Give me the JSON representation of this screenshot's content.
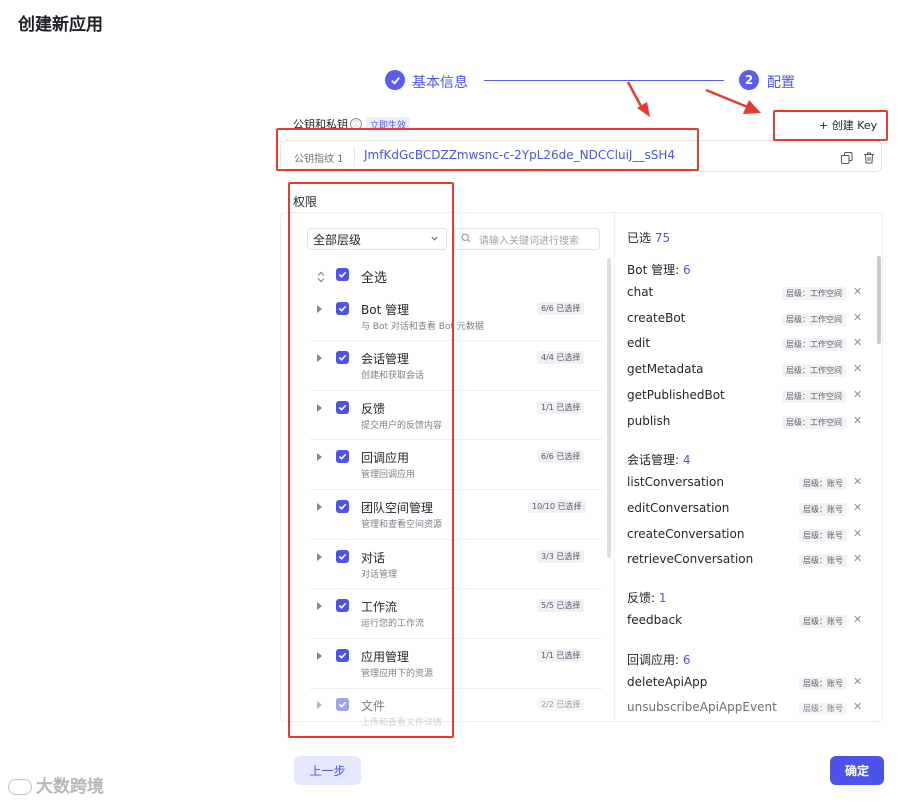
{
  "page": {
    "title": "创建新应用"
  },
  "stepper": {
    "step1": {
      "label": "基本信息"
    },
    "step2": {
      "number": "2",
      "label": "配置"
    }
  },
  "keys": {
    "section_label": "公钥和私钥",
    "info_icon": "ⓘ",
    "tag": "立即生效",
    "create_button": "+ 创建 Key",
    "fingerprint_label": "公钥指纹 1",
    "fingerprint_value": "JmfKdGcBCDZZmwsnc-c-2YpL26de_NDCCluiJ__sSH4"
  },
  "permissions": {
    "title": "权限",
    "filter_value": "全部层级",
    "search_placeholder": "请输入关键词进行搜索",
    "select_all": "全选",
    "groups": [
      {
        "name": "Bot 管理",
        "desc": "与 Bot 对话和查看 Bot 元数据",
        "badge": "6/6 已选择"
      },
      {
        "name": "会话管理",
        "desc": "创建和获取会话",
        "badge": "4/4 已选择"
      },
      {
        "name": "反馈",
        "desc": "提交用户的反馈内容",
        "badge": "1/1 已选择"
      },
      {
        "name": "回调应用",
        "desc": "管理回调应用",
        "badge": "6/6 已选择"
      },
      {
        "name": "团队空间管理",
        "desc": "管理和查看空间资源",
        "badge": "10/10 已选择"
      },
      {
        "name": "对话",
        "desc": "对话管理",
        "badge": "3/3 已选择"
      },
      {
        "name": "工作流",
        "desc": "运行您的工作流",
        "badge": "5/5 已选择"
      },
      {
        "name": "应用管理",
        "desc": "管理应用下的资源",
        "badge": "1/1 已选择"
      },
      {
        "name": "文件",
        "desc": "上传和查看文件详情",
        "badge": "2/2 已选择"
      }
    ]
  },
  "selected": {
    "label": "已选",
    "total": "75",
    "groups": [
      {
        "name": "Bot 管理:",
        "count": "6",
        "items": [
          {
            "api": "chat",
            "scope": "层级：工作空间"
          },
          {
            "api": "createBot",
            "scope": "层级：工作空间"
          },
          {
            "api": "edit",
            "scope": "层级：工作空间"
          },
          {
            "api": "getMetadata",
            "scope": "层级：工作空间"
          },
          {
            "api": "getPublishedBot",
            "scope": "层级：工作空间"
          },
          {
            "api": "publish",
            "scope": "层级：工作空间"
          }
        ]
      },
      {
        "name": "会话管理:",
        "count": "4",
        "items": [
          {
            "api": "listConversation",
            "scope": "层级：账号"
          },
          {
            "api": "editConversation",
            "scope": "层级：账号"
          },
          {
            "api": "createConversation",
            "scope": "层级：账号"
          },
          {
            "api": "retrieveConversation",
            "scope": "层级：账号"
          }
        ]
      },
      {
        "name": "反馈:",
        "count": "1",
        "items": [
          {
            "api": "feedback",
            "scope": "层级：账号"
          }
        ]
      },
      {
        "name": "回调应用:",
        "count": "6",
        "items": [
          {
            "api": "deleteApiApp",
            "scope": "层级：账号"
          },
          {
            "api": "unsubscribeApiAppEvent",
            "scope": "层级：账号"
          }
        ]
      }
    ]
  },
  "footer": {
    "prev": "上一步",
    "confirm": "确定"
  },
  "watermark": "大数跨境",
  "colors": {
    "accent": "#4d53e8",
    "annotation": "#e53b30"
  }
}
